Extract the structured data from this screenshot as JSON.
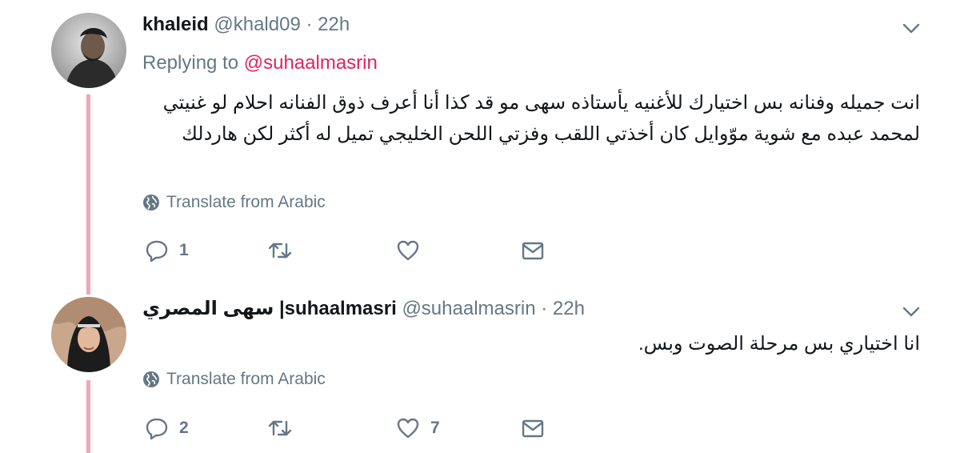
{
  "tweets": [
    {
      "name": "khaleid",
      "handle": "@khald09",
      "separator": "·",
      "time": "22h",
      "replying_prefix": "Replying to ",
      "replying_to": "@suhaalmasrin",
      "body": "انت جميله وفنانه بس اختيارك للأغنيه يأستاذه سهى مو قد كذا أنا أعرف ذوق الفنانه احلام لو غنيتي لمحمد عبده مع شوية موّوايل كان أخذتي اللقب وفزتي اللحن الخليجي تميل له أكثر لكن هاردلك",
      "translate": "Translate from Arabic",
      "replies": "1",
      "retweets": "",
      "likes": ""
    },
    {
      "name": "سهى المصري |suhaalmasri",
      "handle": "@suhaalmasrin",
      "separator": "·",
      "time": "22h",
      "body": "انا اختياري بس مرحلة الصوت وبس.",
      "translate": "Translate from Arabic",
      "replies": "2",
      "retweets": "",
      "likes": "7"
    }
  ],
  "colors": {
    "thread_line": "#f0a5b9",
    "mention": "#e0245e",
    "secondary_text": "#657786"
  },
  "icons": [
    "chevron-down-icon",
    "globe-icon",
    "reply-icon",
    "retweet-icon",
    "like-icon",
    "direct-message-icon"
  ]
}
